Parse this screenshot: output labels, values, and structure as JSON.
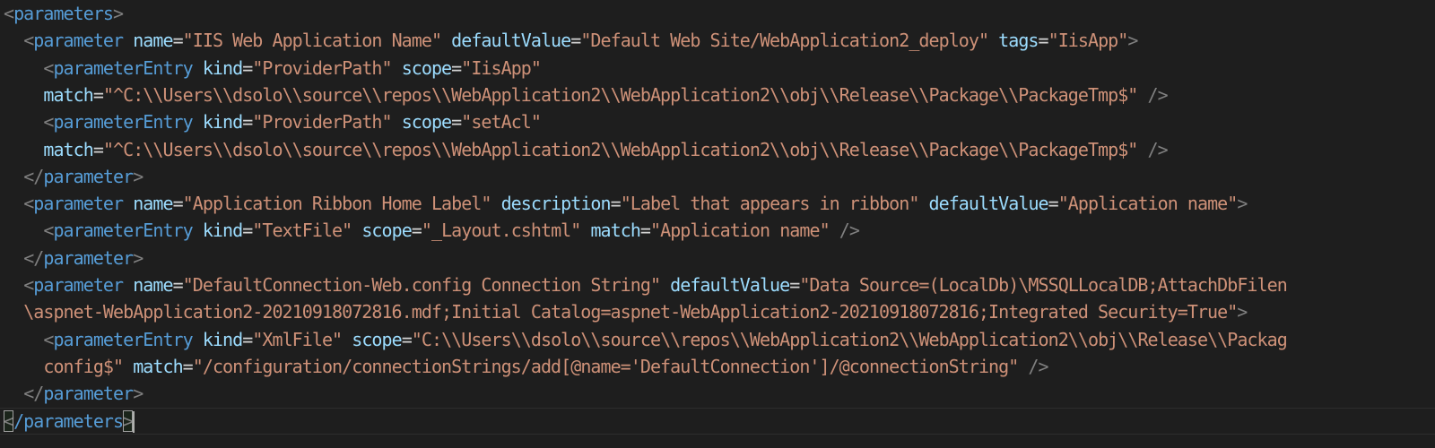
{
  "editor": {
    "colors": {
      "background": "#1e1e1e",
      "tag": "#569cd6",
      "attribute": "#9cdcfe",
      "value": "#ce9178",
      "punctuation": "#808080",
      "text": "#d4d4d4"
    },
    "lines": [
      [
        [
          "punc",
          "<"
        ],
        [
          "tag",
          "parameters"
        ],
        [
          "punc",
          ">"
        ]
      ],
      [
        [
          "text",
          "  "
        ],
        [
          "punc",
          "<"
        ],
        [
          "tag",
          "parameter"
        ],
        [
          "text",
          " "
        ],
        [
          "attr",
          "name"
        ],
        [
          "text",
          "="
        ],
        [
          "val",
          "\"IIS Web Application Name\""
        ],
        [
          "text",
          " "
        ],
        [
          "attr",
          "defaultValue"
        ],
        [
          "text",
          "="
        ],
        [
          "val",
          "\"Default Web Site/WebApplication2_deploy\""
        ],
        [
          "text",
          " "
        ],
        [
          "attr",
          "tags"
        ],
        [
          "text",
          "="
        ],
        [
          "val",
          "\"IisApp\""
        ],
        [
          "punc",
          ">"
        ]
      ],
      [
        [
          "text",
          "    "
        ],
        [
          "punc",
          "<"
        ],
        [
          "tag",
          "parameterEntry"
        ],
        [
          "text",
          " "
        ],
        [
          "attr",
          "kind"
        ],
        [
          "text",
          "="
        ],
        [
          "val",
          "\"ProviderPath\""
        ],
        [
          "text",
          " "
        ],
        [
          "attr",
          "scope"
        ],
        [
          "text",
          "="
        ],
        [
          "val",
          "\"IisApp\""
        ]
      ],
      [
        [
          "text",
          "    "
        ],
        [
          "attr",
          "match"
        ],
        [
          "text",
          "="
        ],
        [
          "val",
          "\"^C:\\\\Users\\\\dsolo\\\\source\\\\repos\\\\WebApplication2\\\\WebApplication2\\\\obj\\\\Release\\\\Package\\\\PackageTmp$\""
        ],
        [
          "text",
          " "
        ],
        [
          "punc",
          "/>"
        ]
      ],
      [
        [
          "text",
          "    "
        ],
        [
          "punc",
          "<"
        ],
        [
          "tag",
          "parameterEntry"
        ],
        [
          "text",
          " "
        ],
        [
          "attr",
          "kind"
        ],
        [
          "text",
          "="
        ],
        [
          "val",
          "\"ProviderPath\""
        ],
        [
          "text",
          " "
        ],
        [
          "attr",
          "scope"
        ],
        [
          "text",
          "="
        ],
        [
          "val",
          "\"setAcl\""
        ]
      ],
      [
        [
          "text",
          "    "
        ],
        [
          "attr",
          "match"
        ],
        [
          "text",
          "="
        ],
        [
          "val",
          "\"^C:\\\\Users\\\\dsolo\\\\source\\\\repos\\\\WebApplication2\\\\WebApplication2\\\\obj\\\\Release\\\\Package\\\\PackageTmp$\""
        ],
        [
          "text",
          " "
        ],
        [
          "punc",
          "/>"
        ]
      ],
      [
        [
          "text",
          "  "
        ],
        [
          "punc",
          "</"
        ],
        [
          "tag",
          "parameter"
        ],
        [
          "punc",
          ">"
        ]
      ],
      [
        [
          "text",
          "  "
        ],
        [
          "punc",
          "<"
        ],
        [
          "tag",
          "parameter"
        ],
        [
          "text",
          " "
        ],
        [
          "attr",
          "name"
        ],
        [
          "text",
          "="
        ],
        [
          "val",
          "\"Application Ribbon Home Label\""
        ],
        [
          "text",
          " "
        ],
        [
          "attr",
          "description"
        ],
        [
          "text",
          "="
        ],
        [
          "val",
          "\"Label that appears in ribbon\""
        ],
        [
          "text",
          " "
        ],
        [
          "attr",
          "defaultValue"
        ],
        [
          "text",
          "="
        ],
        [
          "val",
          "\"Application name\""
        ],
        [
          "punc",
          ">"
        ]
      ],
      [
        [
          "text",
          "    "
        ],
        [
          "punc",
          "<"
        ],
        [
          "tag",
          "parameterEntry"
        ],
        [
          "text",
          " "
        ],
        [
          "attr",
          "kind"
        ],
        [
          "text",
          "="
        ],
        [
          "val",
          "\"TextFile\""
        ],
        [
          "text",
          " "
        ],
        [
          "attr",
          "scope"
        ],
        [
          "text",
          "="
        ],
        [
          "val",
          "\"_Layout.cshtml\""
        ],
        [
          "text",
          " "
        ],
        [
          "attr",
          "match"
        ],
        [
          "text",
          "="
        ],
        [
          "val",
          "\"Application name\""
        ],
        [
          "text",
          " "
        ],
        [
          "punc",
          "/>"
        ]
      ],
      [
        [
          "text",
          "  "
        ],
        [
          "punc",
          "</"
        ],
        [
          "tag",
          "parameter"
        ],
        [
          "punc",
          ">"
        ]
      ],
      [
        [
          "text",
          "  "
        ],
        [
          "punc",
          "<"
        ],
        [
          "tag",
          "parameter"
        ],
        [
          "text",
          " "
        ],
        [
          "attr",
          "name"
        ],
        [
          "text",
          "="
        ],
        [
          "val",
          "\"DefaultConnection-Web.config Connection String\""
        ],
        [
          "text",
          " "
        ],
        [
          "attr",
          "defaultValue"
        ],
        [
          "text",
          "="
        ],
        [
          "val",
          "\"Data Source=(LocalDb)\\MSSQLLocalDB;AttachDbFilen"
        ]
      ],
      [
        [
          "text",
          "  "
        ],
        [
          "val",
          "\\aspnet-WebApplication2-20210918072816.mdf;Initial Catalog=aspnet-WebApplication2-20210918072816;Integrated Security=True\""
        ],
        [
          "punc",
          ">"
        ]
      ],
      [
        [
          "text",
          "    "
        ],
        [
          "punc",
          "<"
        ],
        [
          "tag",
          "parameterEntry"
        ],
        [
          "text",
          " "
        ],
        [
          "attr",
          "kind"
        ],
        [
          "text",
          "="
        ],
        [
          "val",
          "\"XmlFile\""
        ],
        [
          "text",
          " "
        ],
        [
          "attr",
          "scope"
        ],
        [
          "text",
          "="
        ],
        [
          "val",
          "\"C:\\\\Users\\\\dsolo\\\\source\\\\repos\\\\WebApplication2\\\\WebApplication2\\\\obj\\\\Release\\\\Packag"
        ]
      ],
      [
        [
          "text",
          "    "
        ],
        [
          "val",
          "config$\""
        ],
        [
          "text",
          " "
        ],
        [
          "attr",
          "match"
        ],
        [
          "text",
          "="
        ],
        [
          "val",
          "\"/configuration/connectionStrings/add[@name='DefaultConnection']/@connectionString\""
        ],
        [
          "text",
          " "
        ],
        [
          "punc",
          "/>"
        ]
      ],
      [
        [
          "text",
          "  "
        ],
        [
          "punc",
          "</"
        ],
        [
          "tag",
          "parameter"
        ],
        [
          "punc",
          ">"
        ]
      ],
      [
        [
          "bm",
          "<"
        ],
        [
          "tag",
          "/parameters"
        ],
        [
          "bm",
          ">"
        ],
        [
          "cursor",
          ""
        ]
      ]
    ]
  }
}
